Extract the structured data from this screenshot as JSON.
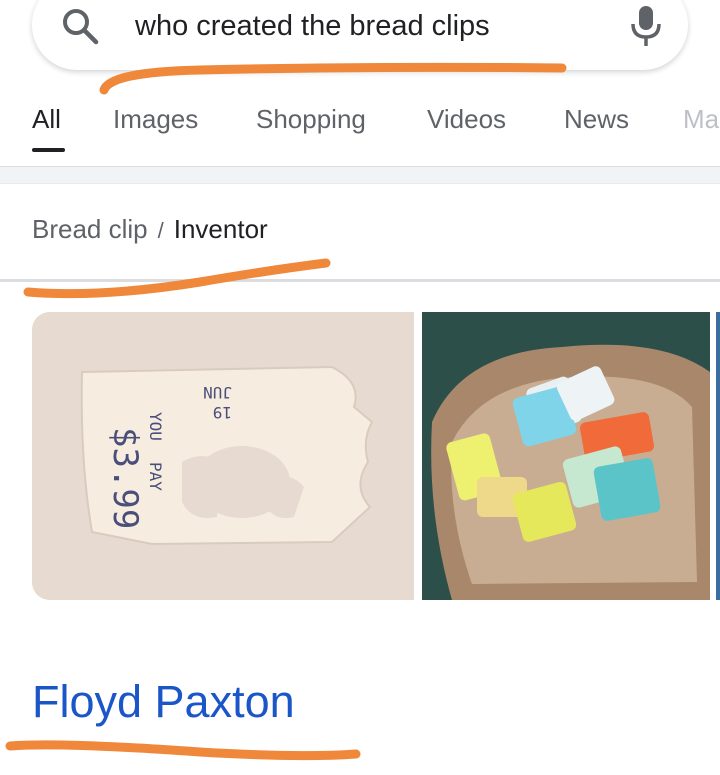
{
  "search": {
    "query": "who created the bread clips"
  },
  "tabs": [
    {
      "label": "All",
      "active": true
    },
    {
      "label": "Images",
      "active": false
    },
    {
      "label": "Shopping",
      "active": false
    },
    {
      "label": "Videos",
      "active": false
    },
    {
      "label": "News",
      "active": false
    },
    {
      "label": "Ma",
      "active": false
    }
  ],
  "breadcrumb": {
    "parent": "Bread clip",
    "separator": "/",
    "current": "Inventor"
  },
  "images": {
    "clip_text": {
      "price": "$3.99",
      "month": "JUN",
      "day": "19",
      "you": "YOU",
      "pay": "PAY"
    }
  },
  "answer": {
    "title": "Floyd Paxton"
  },
  "colors": {
    "link_blue": "#1a56c8",
    "annotation_orange": "#f0883c",
    "icon_gray": "#5f6368"
  }
}
